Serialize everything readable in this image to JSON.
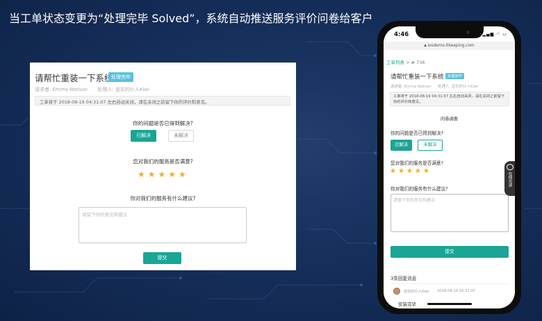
{
  "headline": "当工单状态变更为“处理完毕 Solved”，系统自动推送服务评价问卷给客户",
  "ticket": {
    "title": "请帮忙重装一下系统",
    "status_badge": "处理完毕",
    "requester_label": "请求者:",
    "requester": "Emma Watson",
    "handler_label": "处理人:",
    "handler": "忠实的仆人Kiwi",
    "notice": "工单将于 2018-08-19 04:31:07 左右自动关闭，请在关闭之前留下你的评价和意见。"
  },
  "survey": {
    "heading": "问卷调查",
    "q1": "你的问题是否已得到解决?",
    "solved_label": "已解决",
    "unsolved_label": "未解决",
    "q2_desktop": "您对我们的服务是否满意?",
    "q2_mobile": "您对我们的服务是否满意?",
    "stars": "★★★★★",
    "rating": 5,
    "q3": "你对我们的服务有什么建议?",
    "suggestion_placeholder": "请留下你的意见和建议",
    "submit_label": "提交"
  },
  "mobile": {
    "time": "4:46",
    "status_icons": "▂▄▆ ◠ ▭",
    "url": "iosdemo.itkeeping.com",
    "breadcrumb_link": "工单列表",
    "breadcrumb_sep": " > ",
    "breadcrumb_current": "# 736",
    "chat_tab": "在线交谈",
    "replies_heading": "3条回复消息",
    "reply_author": "忠实的仆人Kiwi",
    "reply_time": "2018-08-16 16:31:07",
    "reply_body": "安装完毕"
  },
  "colors": {
    "accent": "#1aa594",
    "badge": "#5bc0de",
    "star": "#f0ad2a",
    "background": "#16305c"
  }
}
